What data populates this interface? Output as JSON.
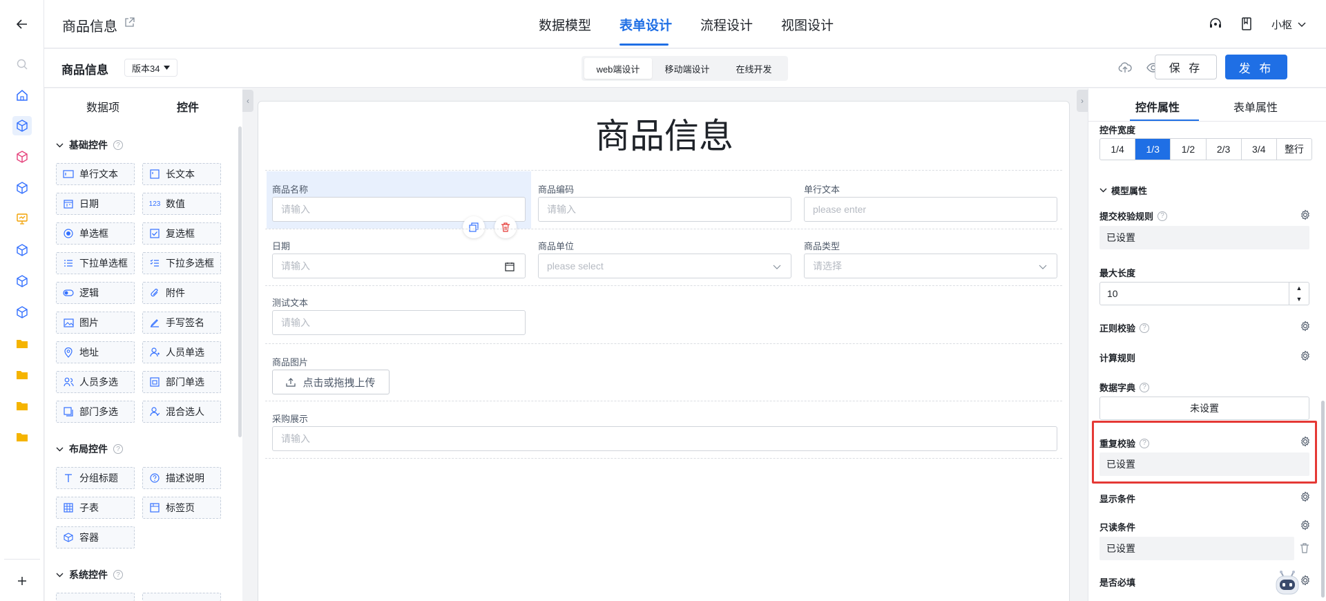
{
  "header": {
    "app_title": "商品信息",
    "nav_tabs": [
      {
        "label": "数据模型"
      },
      {
        "label": "表单设计"
      },
      {
        "label": "流程设计"
      },
      {
        "label": "视图设计"
      }
    ],
    "user_name": "小枢"
  },
  "subbar": {
    "form_name": "商品信息",
    "version_label": "版本34",
    "design_modes": [
      "web端设计",
      "移动端设计",
      "在线开发"
    ],
    "save_label": "保 存",
    "publish_label": "发 布"
  },
  "left_panel": {
    "tabs": [
      "数据项",
      "控件"
    ],
    "groups": [
      {
        "title": "基础控件",
        "items": [
          "单行文本",
          "长文本",
          "日期",
          "数值",
          "单选框",
          "复选框",
          "下拉单选框",
          "下拉多选框",
          "逻辑",
          "附件",
          "图片",
          "手写签名",
          "地址",
          "人员单选",
          "人员多选",
          "部门单选",
          "部门多选",
          "混合选人"
        ]
      },
      {
        "title": "布局控件",
        "items": [
          "分组标题",
          "描述说明",
          "子表",
          "标签页",
          "容器"
        ]
      },
      {
        "title": "系统控件",
        "items": []
      }
    ]
  },
  "canvas": {
    "title": "商品信息",
    "fields": {
      "name": {
        "label": "商品名称",
        "placeholder": "请输入"
      },
      "code": {
        "label": "商品编码",
        "placeholder": "请输入"
      },
      "text": {
        "label": "单行文本",
        "placeholder": "please enter"
      },
      "date": {
        "label": "日期",
        "placeholder": "请输入"
      },
      "unit": {
        "label": "商品单位",
        "placeholder": "please select"
      },
      "type": {
        "label": "商品类型",
        "placeholder": "请选择"
      },
      "test": {
        "label": "测试文本",
        "placeholder": "请输入"
      },
      "image": {
        "label": "商品图片",
        "button": "点击或拖拽上传"
      },
      "purchase": {
        "label": "采购展示",
        "placeholder": "请输入"
      }
    }
  },
  "right_panel": {
    "tabs": [
      "控件属性",
      "表单属性"
    ],
    "width_label": "控件宽度",
    "width_options": [
      "1/4",
      "1/3",
      "1/2",
      "2/3",
      "3/4",
      "整行"
    ],
    "width_selected": "1/3",
    "model_section": "模型属性",
    "submit_rule": {
      "label": "提交校验规则",
      "value": "已设置"
    },
    "max_length": {
      "label": "最大长度",
      "value": "10"
    },
    "regex": {
      "label": "正则校验"
    },
    "calc_rule": {
      "label": "计算规则"
    },
    "dictionary": {
      "label": "数据字典",
      "value": "未设置"
    },
    "duplicate": {
      "label": "重复校验",
      "value": "已设置"
    },
    "display_cond": {
      "label": "显示条件"
    },
    "readonly_cond": {
      "label": "只读条件",
      "value": "已设置"
    },
    "required": {
      "label": "是否必填"
    }
  },
  "colors": {
    "accent": "#1f6fe5",
    "highlight": "#e53935"
  }
}
